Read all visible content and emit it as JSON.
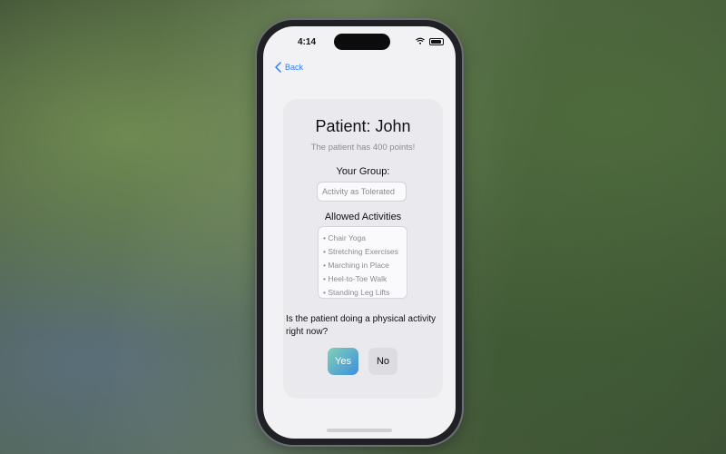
{
  "status_bar": {
    "time": "4:14"
  },
  "nav": {
    "back_label": "Back"
  },
  "patient": {
    "title": "Patient: John",
    "points_text": "The patient has 400 points!"
  },
  "group": {
    "label": "Your Group:",
    "value": "Activity as Tolerated"
  },
  "activities": {
    "label": "Allowed Activities",
    "items": [
      "• Chair Yoga",
      "• Stretching Exercises",
      "• Marching in Place",
      "• Heel-to-Toe Walk",
      "• Standing Leg Lifts"
    ]
  },
  "prompt": {
    "question": "Is the patient doing a physical activity right now?",
    "yes_label": "Yes",
    "no_label": "No"
  },
  "colors": {
    "accent": "#2f7cf6",
    "yes_gradient_start": "#7fd0b6",
    "yes_gradient_end": "#3f8fe0"
  },
  "icons": [
    "chevron-left-icon",
    "wifi-icon",
    "battery-icon"
  ]
}
